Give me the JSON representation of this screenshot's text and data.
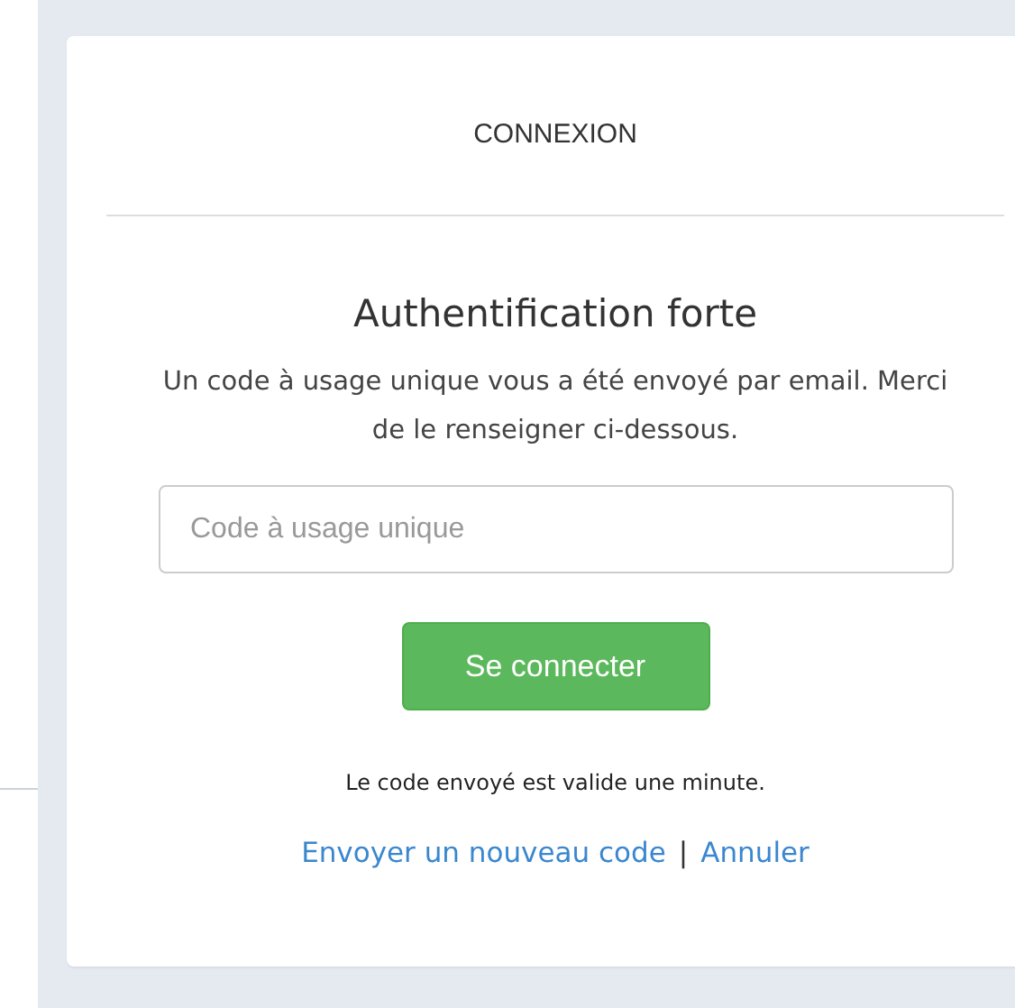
{
  "card": {
    "header": "CONNEXION",
    "title": "Authentification forte",
    "description": "Un code à usage unique vous a été envoyé par email. Merci de le renseigner ci-dessous.",
    "code_field": {
      "placeholder": "Code à usage unique"
    },
    "submit_button": "Se connecter",
    "validity_note": "Le code envoyé est valide une minute.",
    "links": [
      "Envoyer un nouveau code",
      "Annuler"
    ],
    "link_separator": "|"
  }
}
